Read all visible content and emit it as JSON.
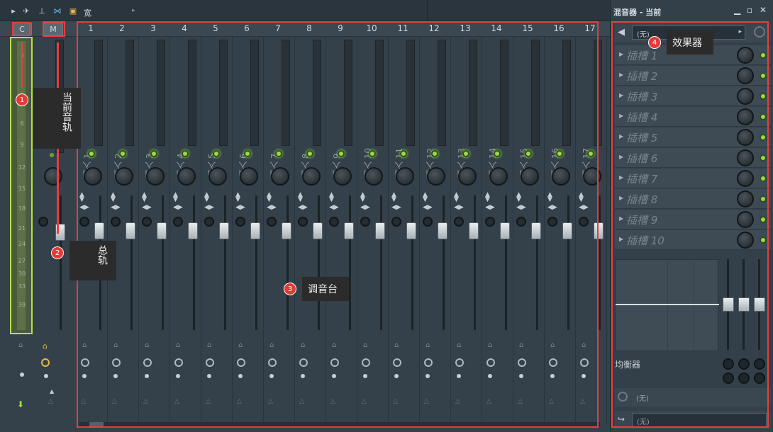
{
  "toolbar": {
    "title": "宽"
  },
  "header": {
    "current_label": "C",
    "master_label": "M"
  },
  "channels": [
    {
      "num": "1",
      "name": "插入 1"
    },
    {
      "num": "2",
      "name": "插入 2"
    },
    {
      "num": "3",
      "name": "插入 3"
    },
    {
      "num": "4",
      "name": "插入 4"
    },
    {
      "num": "5",
      "name": "插入 5"
    },
    {
      "num": "6",
      "name": "插入 6"
    },
    {
      "num": "7",
      "name": "插入 7"
    },
    {
      "num": "8",
      "name": "插入 8"
    },
    {
      "num": "9",
      "name": "插入 9"
    },
    {
      "num": "10",
      "name": "插入 10"
    },
    {
      "num": "11",
      "name": "插入 11"
    },
    {
      "num": "12",
      "name": "插入 12"
    },
    {
      "num": "13",
      "name": "插入 13"
    },
    {
      "num": "14",
      "name": "插入 14"
    },
    {
      "num": "15",
      "name": "插入 15"
    },
    {
      "num": "16",
      "name": "插入 16"
    },
    {
      "num": "17",
      "name": "插入 17"
    }
  ],
  "meter_scale": [
    "3",
    "6",
    "9",
    "12",
    "15",
    "18",
    "21",
    "24",
    "27",
    "30",
    "33",
    "39"
  ],
  "panel": {
    "title": "混音器 - 当前",
    "fx_select": "(无)",
    "slots": [
      "插槽 1",
      "插槽 2",
      "插槽 3",
      "插槽 4",
      "插槽 5",
      "插槽 6",
      "插槽 7",
      "插槽 8",
      "插槽 9",
      "插槽 10"
    ],
    "eq_label": "均衡器",
    "time_value": "(无)",
    "output_value": "(无)"
  },
  "annotations": {
    "a1": {
      "num": "1",
      "text": "当前音轨"
    },
    "a2": {
      "num": "2",
      "text": "总轨"
    },
    "a3": {
      "num": "3",
      "text": "调音台"
    },
    "a4": {
      "num": "4",
      "text": "效果器"
    }
  },
  "colors": {
    "accent_green": "#8fe23b",
    "annotation_red": "#e83d3d"
  }
}
